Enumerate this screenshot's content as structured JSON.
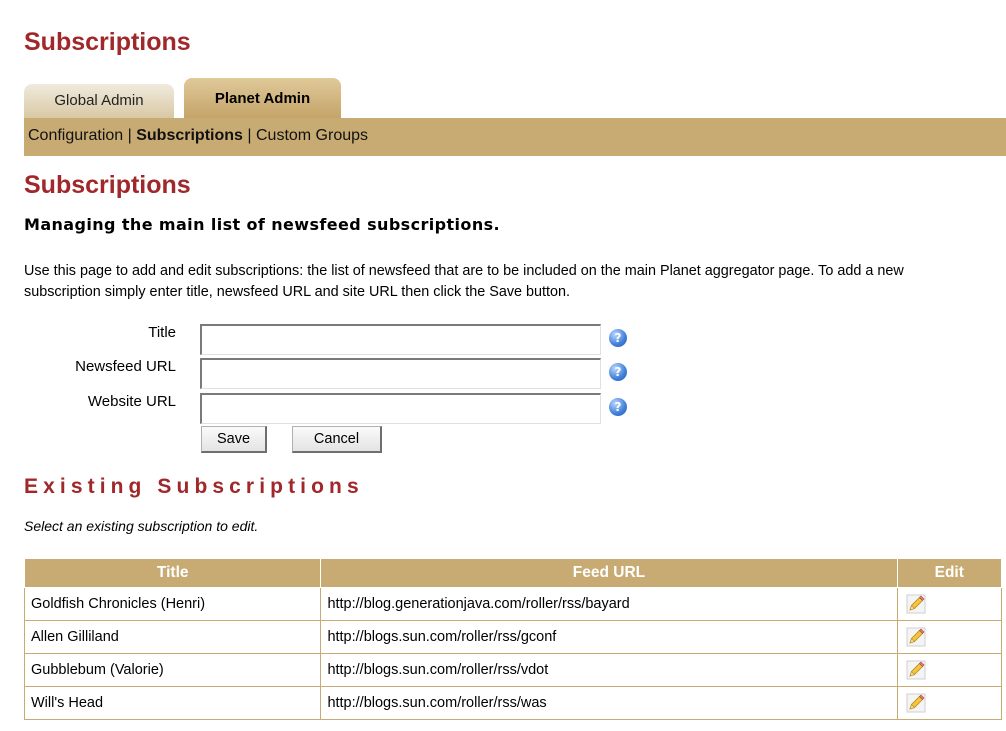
{
  "page_title": "Subscriptions",
  "tabs": [
    {
      "label": "Global Admin",
      "active": false
    },
    {
      "label": "Planet Admin",
      "active": true
    }
  ],
  "subnav": {
    "items": [
      {
        "label": "Configuration",
        "active": false
      },
      {
        "label": "Subscriptions",
        "active": true
      },
      {
        "label": "Custom Groups",
        "active": false
      }
    ],
    "separator": "|"
  },
  "section_title": "Subscriptions",
  "subtitle": "Managing the main list of newsfeed subscriptions.",
  "description": "Use this page to add and edit subscriptions: the list of newsfeed that are to be included on the main Planet aggregator page. To add a new subscription simply enter title, newsfeed URL and site URL then click the Save button.",
  "form": {
    "fields": [
      {
        "label": "Title",
        "value": "",
        "help_icon": "help-icon"
      },
      {
        "label": "Newsfeed URL",
        "value": "",
        "help_icon": "help-icon"
      },
      {
        "label": "Website URL",
        "value": "",
        "help_icon": "help-icon"
      }
    ],
    "save_label": "Save",
    "cancel_label": "Cancel"
  },
  "existing": {
    "title": "Existing Subscriptions",
    "hint": "Select an existing subscription to edit.",
    "columns": [
      "Title",
      "Feed URL",
      "Edit"
    ],
    "rows": [
      {
        "title": "Goldfish Chronicles (Henri)",
        "feed_url": "http://blog.generationjava.com/roller/rss/bayard",
        "edit_icon": "pencil-edit-icon"
      },
      {
        "title": "Allen Gilliland",
        "feed_url": "http://blogs.sun.com/roller/rss/gconf",
        "edit_icon": "pencil-edit-icon"
      },
      {
        "title": "Gubblebum (Valorie)",
        "feed_url": "http://blogs.sun.com/roller/rss/vdot",
        "edit_icon": "pencil-edit-icon"
      },
      {
        "title": "Will's Head",
        "feed_url": "http://blogs.sun.com/roller/rss/was",
        "edit_icon": "pencil-edit-icon"
      }
    ]
  },
  "colors": {
    "heading": "#a0282a",
    "accent": "#c8ab72",
    "tab_active": "#c4a468",
    "tab_inactive": "#e6dcc4"
  }
}
